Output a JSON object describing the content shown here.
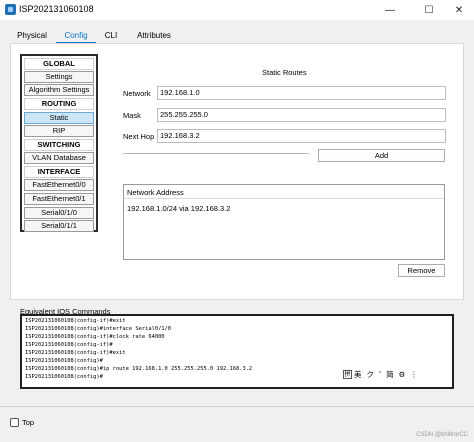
{
  "window": {
    "title": "ISP202131060108",
    "minimize_icon": "—",
    "maximize_icon": "☐",
    "close_icon": "✕"
  },
  "tabs": [
    {
      "label": "Physical",
      "active": false
    },
    {
      "label": "Config",
      "active": true
    },
    {
      "label": "CLI",
      "active": false
    },
    {
      "label": "Attributes",
      "active": false
    }
  ],
  "sidebar": {
    "items": [
      {
        "label": "GLOBAL",
        "type": "header"
      },
      {
        "label": "Settings",
        "type": "item"
      },
      {
        "label": "Algorithm Settings",
        "type": "item"
      },
      {
        "label": "ROUTING",
        "type": "header"
      },
      {
        "label": "Static",
        "type": "item",
        "selected": true
      },
      {
        "label": "RIP",
        "type": "item"
      },
      {
        "label": "SWITCHING",
        "type": "header"
      },
      {
        "label": "VLAN Database",
        "type": "item"
      },
      {
        "label": "INTERFACE",
        "type": "header"
      },
      {
        "label": "FastEthernet0/0",
        "type": "item"
      },
      {
        "label": "FastEthernet0/1",
        "type": "item"
      },
      {
        "label": "Serial0/1/0",
        "type": "item"
      },
      {
        "label": "Serial0/1/1",
        "type": "item"
      }
    ]
  },
  "static_routes": {
    "title": "Static Routes",
    "network_label": "Network",
    "network_value": "192.168.1.0",
    "mask_label": "Mask",
    "mask_value": "255.255.255.0",
    "nexthop_label": "Next Hop",
    "nexthop_value": "192.168.3.2",
    "add_label": "Add",
    "network_address_header": "Network Address",
    "routes": [
      "192.168.1.0/24 via 192.168.3.2"
    ],
    "remove_label": "Remove"
  },
  "ios": {
    "label": "Equivalent IOS Commands",
    "lines": [
      "ISP202131060108(config-if)#exit",
      "ISP202131060108(config)#interface Serial0/1/0",
      "ISP202131060108(config-if)#clock rate 64000",
      "ISP202131060108(config-if)#",
      "ISP202131060108(config-if)#exit",
      "ISP202131060108(config)#",
      "ISP202131060108(config)#ip route 192.168.1.0 255.255.255.0 192.168.3.2",
      "ISP202131060108(config)#"
    ],
    "ime_items": [
      "拼",
      "美",
      "ク",
      "'",
      "简",
      "⚙",
      "⋮"
    ]
  },
  "footer": {
    "top_label": "Top",
    "top_checked": false,
    "watermark": "CSDN @bhiltrorCC"
  }
}
